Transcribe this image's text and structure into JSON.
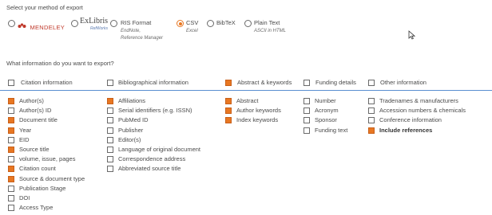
{
  "export": {
    "heading": "Select your method of export",
    "options": [
      {
        "logo_text": "MENDELEY"
      },
      {
        "logo_text": "ExLibris",
        "logo_sub": "RefWorks"
      },
      {
        "label": "RIS Format",
        "sub1": "EndNote,",
        "sub2": "Reference Manager"
      },
      {
        "label": "CSV",
        "sub1": "Excel",
        "selected": true
      },
      {
        "label": "BibTeX"
      },
      {
        "label": "Plain Text",
        "sub1": "ASCII in HTML"
      }
    ]
  },
  "info": {
    "heading": "What information do you want to export?",
    "groups": [
      {
        "label": "Citation information",
        "checked": false
      },
      {
        "label": "Bibliographical information",
        "checked": false
      },
      {
        "label": "Abstract & keywords",
        "checked": true
      },
      {
        "label": "Funding details",
        "checked": false
      },
      {
        "label": "Other information",
        "checked": false
      }
    ],
    "citation": [
      {
        "label": "Author(s)",
        "checked": true
      },
      {
        "label": "Author(s) ID",
        "checked": false
      },
      {
        "label": "Document title",
        "checked": true
      },
      {
        "label": "Year",
        "checked": true
      },
      {
        "label": "EID",
        "checked": false
      },
      {
        "label": "Source title",
        "checked": true
      },
      {
        "label": "volume, issue, pages",
        "checked": false
      },
      {
        "label": "Citation count",
        "checked": true
      },
      {
        "label": "Source & document type",
        "checked": true
      },
      {
        "label": "Publication Stage",
        "checked": false
      },
      {
        "label": "DOI",
        "checked": false
      },
      {
        "label": "Access Type",
        "checked": false
      }
    ],
    "bibliographical": [
      {
        "label": "Affiliations",
        "checked": true
      },
      {
        "label": "Serial identifiers (e.g. ISSN)",
        "checked": false
      },
      {
        "label": "PubMed ID",
        "checked": false
      },
      {
        "label": "Publisher",
        "checked": false
      },
      {
        "label": "Editor(s)",
        "checked": false
      },
      {
        "label": "Language of original document",
        "checked": false
      },
      {
        "label": "Correspondence address",
        "checked": false
      },
      {
        "label": "Abbreviated source title",
        "checked": false
      }
    ],
    "abstract": [
      {
        "label": "Abstract",
        "checked": true
      },
      {
        "label": "Author keywords",
        "checked": true
      },
      {
        "label": "Index keywords",
        "checked": true
      }
    ],
    "funding": [
      {
        "label": "Number",
        "checked": false
      },
      {
        "label": "Acronym",
        "checked": false
      },
      {
        "label": "Sponsor",
        "checked": false
      },
      {
        "label": "Funding text",
        "checked": false
      }
    ],
    "other": [
      {
        "label": "Tradenames & manufacturers",
        "checked": false
      },
      {
        "label": "Accession numbers & chemicals",
        "checked": false
      },
      {
        "label": "Conference information",
        "checked": false
      },
      {
        "label": "Include references",
        "checked": true,
        "bold": true
      }
    ]
  },
  "colors": {
    "accent": "#e87722",
    "divider": "#5a8fd0"
  },
  "icons": {
    "cursor": "mouse-pointer-icon"
  }
}
